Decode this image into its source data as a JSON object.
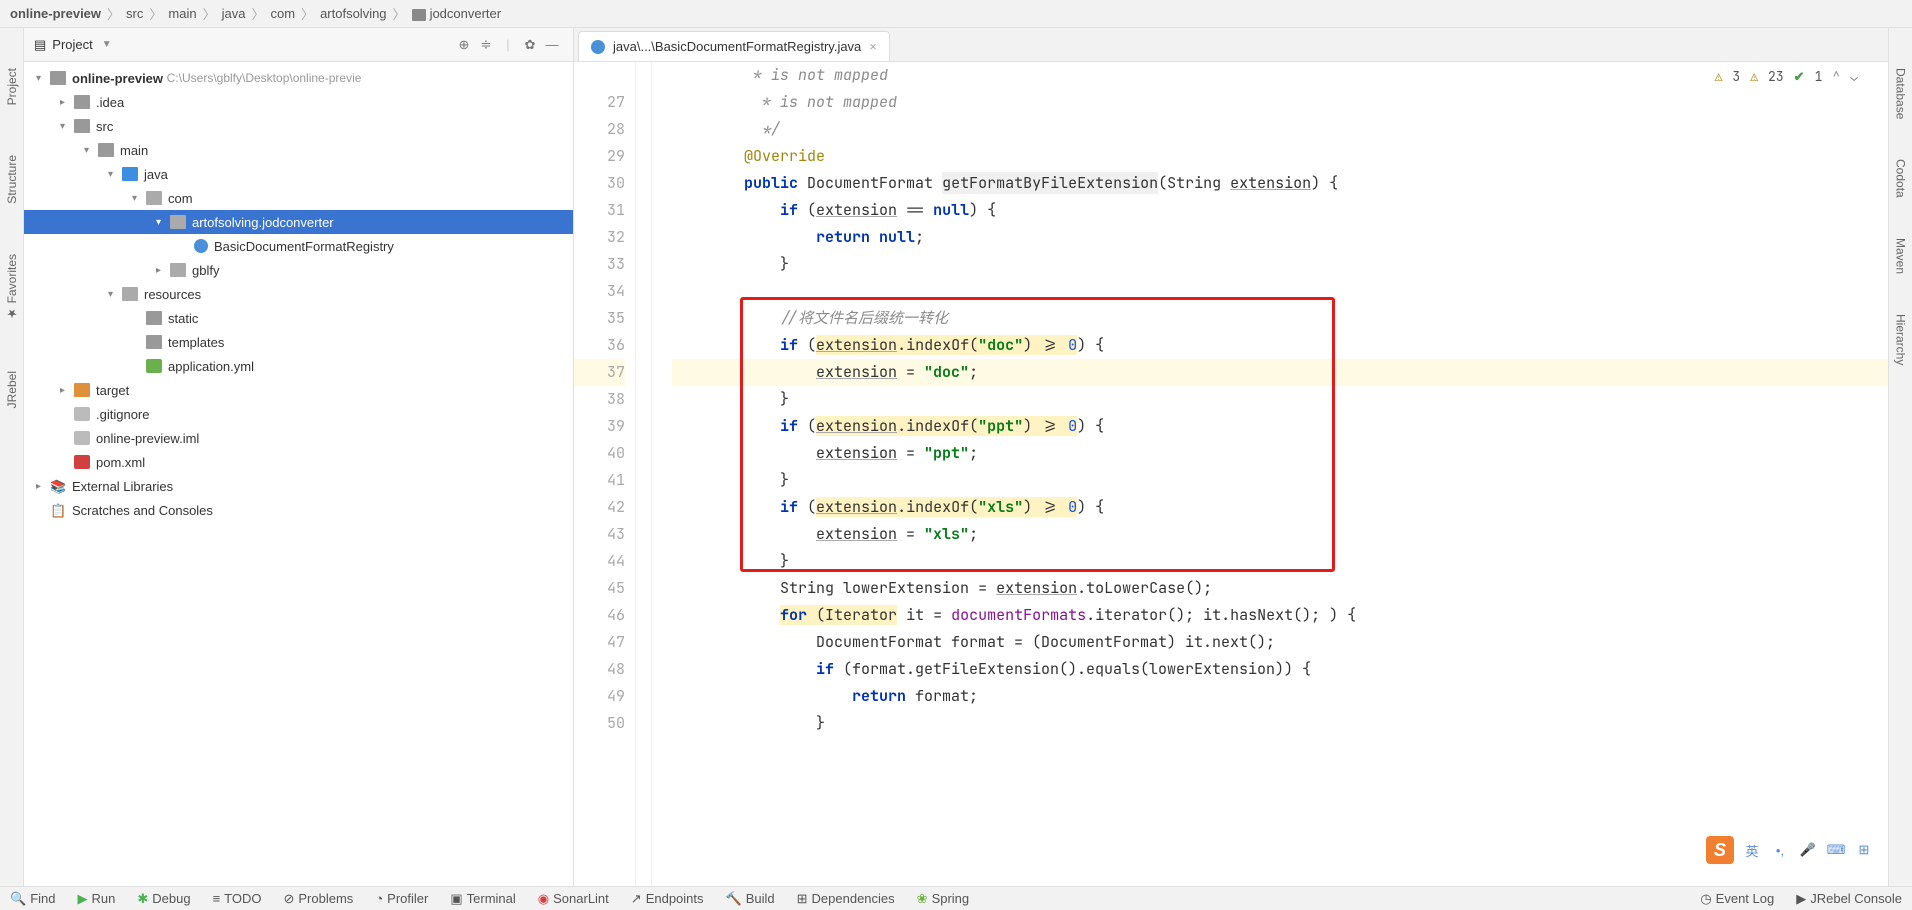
{
  "breadcrumb": [
    "online-preview",
    "src",
    "main",
    "java",
    "com",
    "artofsolving",
    "jodconverter"
  ],
  "leftRail": {
    "project": "Project",
    "structure": "Structure",
    "favorites": "Favorites",
    "jrebel": "JRebel"
  },
  "rightRail": {
    "database": "Database",
    "codota": "Codota",
    "maven": "Maven",
    "hierarchy": "Hierarchy"
  },
  "projectHeader": {
    "title": "Project"
  },
  "tree": {
    "root": {
      "name": "online-preview",
      "path": "C:\\Users\\gblfy\\Desktop\\online-previe"
    },
    "idea": ".idea",
    "src": "src",
    "main": "main",
    "java": "java",
    "com": "com",
    "pkg": "artofsolving.jodconverter",
    "registry": "BasicDocumentFormatRegistry",
    "gblfy": "gblfy",
    "resources": "resources",
    "static": "static",
    "templates": "templates",
    "appyml": "application.yml",
    "target": "target",
    "gitignore": ".gitignore",
    "iml": "online-preview.iml",
    "pom": "pom.xml",
    "extLibs": "External Libraries",
    "scratches": "Scratches and Consoles"
  },
  "tab": {
    "label": "java\\...\\BasicDocumentFormatRegistry.java"
  },
  "inspections": {
    "warn1": "3",
    "warn2": "23",
    "ok": "1"
  },
  "code": {
    "lines": [
      27,
      28,
      29,
      30,
      31,
      32,
      33,
      34,
      35,
      36,
      37,
      38,
      39,
      40,
      41,
      42,
      43,
      44,
      45,
      46,
      47,
      48,
      49,
      50
    ],
    "l27": " * is not mapped",
    "l28": " */",
    "l29_annot": "@Override",
    "l30_kw_public": "public",
    "l30_type": "DocumentFormat",
    "l30_method": "getFormatByFileExtension",
    "l30_ptype": "String",
    "l30_pname": "extension",
    "l31_if": "if",
    "l31_ext": "extension",
    "l31_null": "null",
    "l32_return": "return",
    "l32_null": "null",
    "l35_cmt": "//将文件名后缀统一转化",
    "l36_if": "if",
    "l36_ext": "extension",
    "l36_idx": ".indexOf(",
    "l36_str": "\"doc\"",
    "l36_tail": ") >= ",
    "l36_num": "0",
    "l37_ext": "extension",
    "l37_str": "\"doc\"",
    "l39_if": "if",
    "l39_ext": "extension",
    "l39_str": "\"ppt\"",
    "l39_num": "0",
    "l40_ext": "extension",
    "l40_str": "\"ppt\"",
    "l42_if": "if",
    "l42_ext": "extension",
    "l42_str": "\"xls\"",
    "l42_num": "0",
    "l43_ext": "extension",
    "l43_str": "\"xls\"",
    "l45_type": "String",
    "l45_var": "lowerExtension",
    "l45_ext": "extension",
    "l45_call": ".toLowerCase();",
    "l46_for": "for",
    "l46_iter": "Iterator",
    "l46_it": "it = ",
    "l46_df": "documentFormats",
    "l46_tail": ".iterator(); it.hasNext(); ) {",
    "l47_line": "DocumentFormat format = (DocumentFormat) it.next();",
    "l48_if": "if",
    "l48_call": " (format.getFileExtension().equals(lowerExtension)) {",
    "l49_return": "return",
    "l49_var": " format;"
  },
  "bottomBar": {
    "find": "Find",
    "run": "Run",
    "debug": "Debug",
    "todo": "TODO",
    "problems": "Problems",
    "profiler": "Profiler",
    "terminal": "Terminal",
    "sonarlint": "SonarLint",
    "endpoints": "Endpoints",
    "build": "Build",
    "deps": "Dependencies",
    "spring": "Spring",
    "eventlog": "Event Log",
    "jrebel": "JRebel Console"
  },
  "ime": {
    "lang": "英"
  }
}
